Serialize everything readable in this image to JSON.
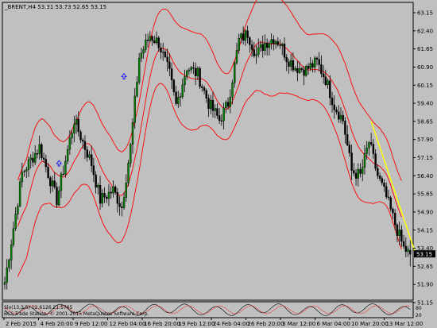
{
  "window": {
    "title": "_BRENT,H4  53.31 53.73 52.65 53.15",
    "current_price_label": "53.15",
    "watermark": "BCS Trade Station, © 2001-2015 MetaQuotes Software Corp.",
    "indicator_caption": "Slo(13,3,5) 12.6126 21.5765",
    "indicator_levels": [
      "80",
      "20"
    ]
  },
  "colors": {
    "background": "#c0c0c0",
    "bull_candle": "#008000",
    "bear_candle": "#000000",
    "bands": "#ff0000",
    "trendline": "#ffff00",
    "current_price_box": "#000000",
    "arrow": "#0000ff"
  },
  "chart_data": {
    "type": "candlestick",
    "symbol": "_BRENT",
    "timeframe": "H4",
    "last": {
      "open": 53.31,
      "high": 53.73,
      "low": 52.65,
      "close": 53.15
    },
    "y_ticks": [
      "63.15",
      "62.40",
      "61.65",
      "60.90",
      "60.15",
      "59.40",
      "58.65",
      "57.90",
      "57.15",
      "56.40",
      "55.65",
      "54.90",
      "54.15",
      "53.40",
      "52.65",
      "51.90",
      "51.15"
    ],
    "ylim": [
      51.15,
      63.15
    ],
    "x_ticks": [
      "2 Feb 2015",
      "4 Feb 20:00",
      "9 Feb 12:00",
      "12 Feb 04:00",
      "16 Feb 20:00",
      "19 Feb 12:00",
      "24 Feb 04:00",
      "26 Feb 20:00",
      "3 Mar 12:00",
      "6 Mar 04:00",
      "10 Mar 20:00",
      "13 Mar 12:00"
    ],
    "anchors": [
      [
        0,
        52.0
      ],
      [
        8,
        56.5
      ],
      [
        16,
        57.6
      ],
      [
        24,
        55.4
      ],
      [
        32,
        58.7
      ],
      [
        40,
        56.9
      ],
      [
        44,
        55.4
      ],
      [
        50,
        55.8
      ],
      [
        54,
        55.1
      ],
      [
        58,
        57.6
      ],
      [
        62,
        61.3
      ],
      [
        67,
        62.2
      ],
      [
        71,
        61.9
      ],
      [
        76,
        60.6
      ],
      [
        79,
        59.3
      ],
      [
        84,
        60.9
      ],
      [
        89,
        60.6
      ],
      [
        94,
        59.4
      ],
      [
        99,
        58.7
      ],
      [
        103,
        59.4
      ],
      [
        108,
        62.0
      ],
      [
        112,
        62.3
      ],
      [
        116,
        61.4
      ],
      [
        120,
        61.9
      ],
      [
        124,
        62.1
      ],
      [
        127,
        61.9
      ],
      [
        130,
        61.3
      ],
      [
        134,
        60.9
      ],
      [
        139,
        60.8
      ],
      [
        144,
        61.1
      ],
      [
        148,
        60.4
      ],
      [
        152,
        59.3
      ],
      [
        156,
        58.7
      ],
      [
        160,
        56.6
      ],
      [
        164,
        56.4
      ],
      [
        168,
        57.8
      ],
      [
        172,
        56.4
      ],
      [
        176,
        55.5
      ],
      [
        180,
        54.4
      ],
      [
        184,
        53.4
      ],
      [
        187,
        53.15
      ]
    ],
    "bands_offset": 1.7,
    "trendline": {
      "x1": 169,
      "y1": 58.65,
      "x2": 189,
      "y2": 53.3
    }
  }
}
